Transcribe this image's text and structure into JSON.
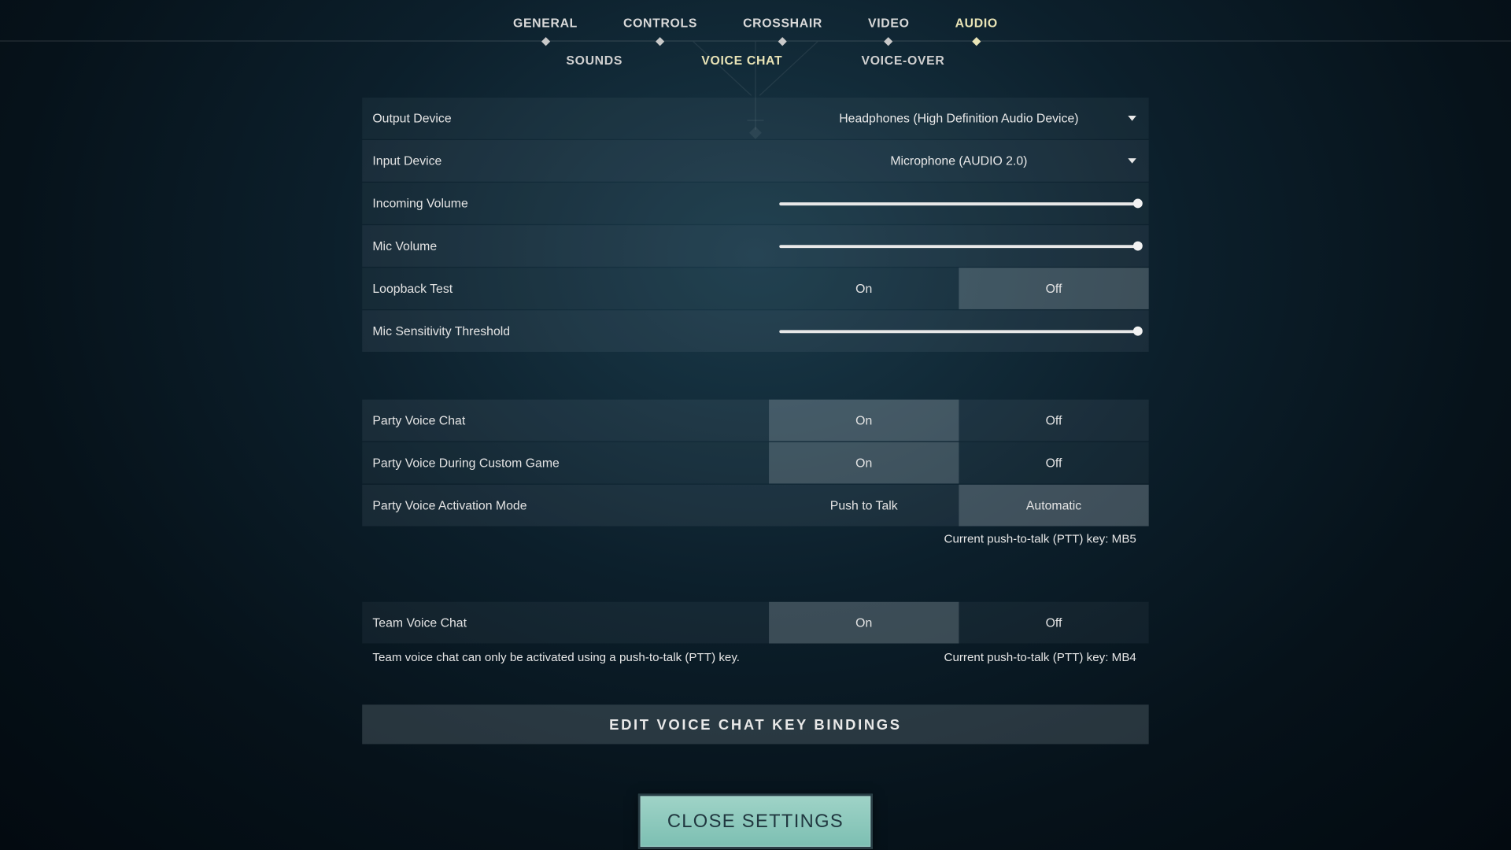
{
  "tabs": {
    "main": [
      "GENERAL",
      "CONTROLS",
      "CROSSHAIR",
      "VIDEO",
      "AUDIO"
    ],
    "main_active": "AUDIO",
    "sub": [
      "SOUNDS",
      "VOICE CHAT",
      "VOICE-OVER"
    ],
    "sub_active": "VOICE CHAT"
  },
  "rows": {
    "output_device": {
      "label": "Output Device",
      "value": "Headphones (High Definition Audio Device)"
    },
    "input_device": {
      "label": "Input Device",
      "value": "Microphone (AUDIO 2.0)"
    },
    "incoming_volume": {
      "label": "Incoming Volume",
      "value": 100
    },
    "mic_volume": {
      "label": "Mic Volume",
      "value": 100
    },
    "loopback": {
      "label": "Loopback Test",
      "options": [
        "On",
        "Off"
      ],
      "selected": "Off"
    },
    "mic_sensitivity": {
      "label": "Mic Sensitivity Threshold",
      "value": 100
    },
    "party_voice": {
      "label": "Party Voice Chat",
      "options": [
        "On",
        "Off"
      ],
      "selected": "On"
    },
    "party_voice_custom": {
      "label": "Party Voice During Custom Game",
      "options": [
        "On",
        "Off"
      ],
      "selected": "On"
    },
    "party_activation": {
      "label": "Party Voice Activation Mode",
      "options": [
        "Push to Talk",
        "Automatic"
      ],
      "selected": "Automatic"
    },
    "team_voice": {
      "label": "Team Voice Chat",
      "options": [
        "On",
        "Off"
      ],
      "selected": "On"
    }
  },
  "hints": {
    "party_ptt": "Current push-to-talk (PTT) key: MB5",
    "team_note": "Team voice chat can only be activated using a push-to-talk (PTT) key.",
    "team_ptt": "Current push-to-talk (PTT) key: MB4"
  },
  "buttons": {
    "edit_bindings": "EDIT VOICE CHAT KEY BINDINGS",
    "close": "CLOSE SETTINGS"
  }
}
